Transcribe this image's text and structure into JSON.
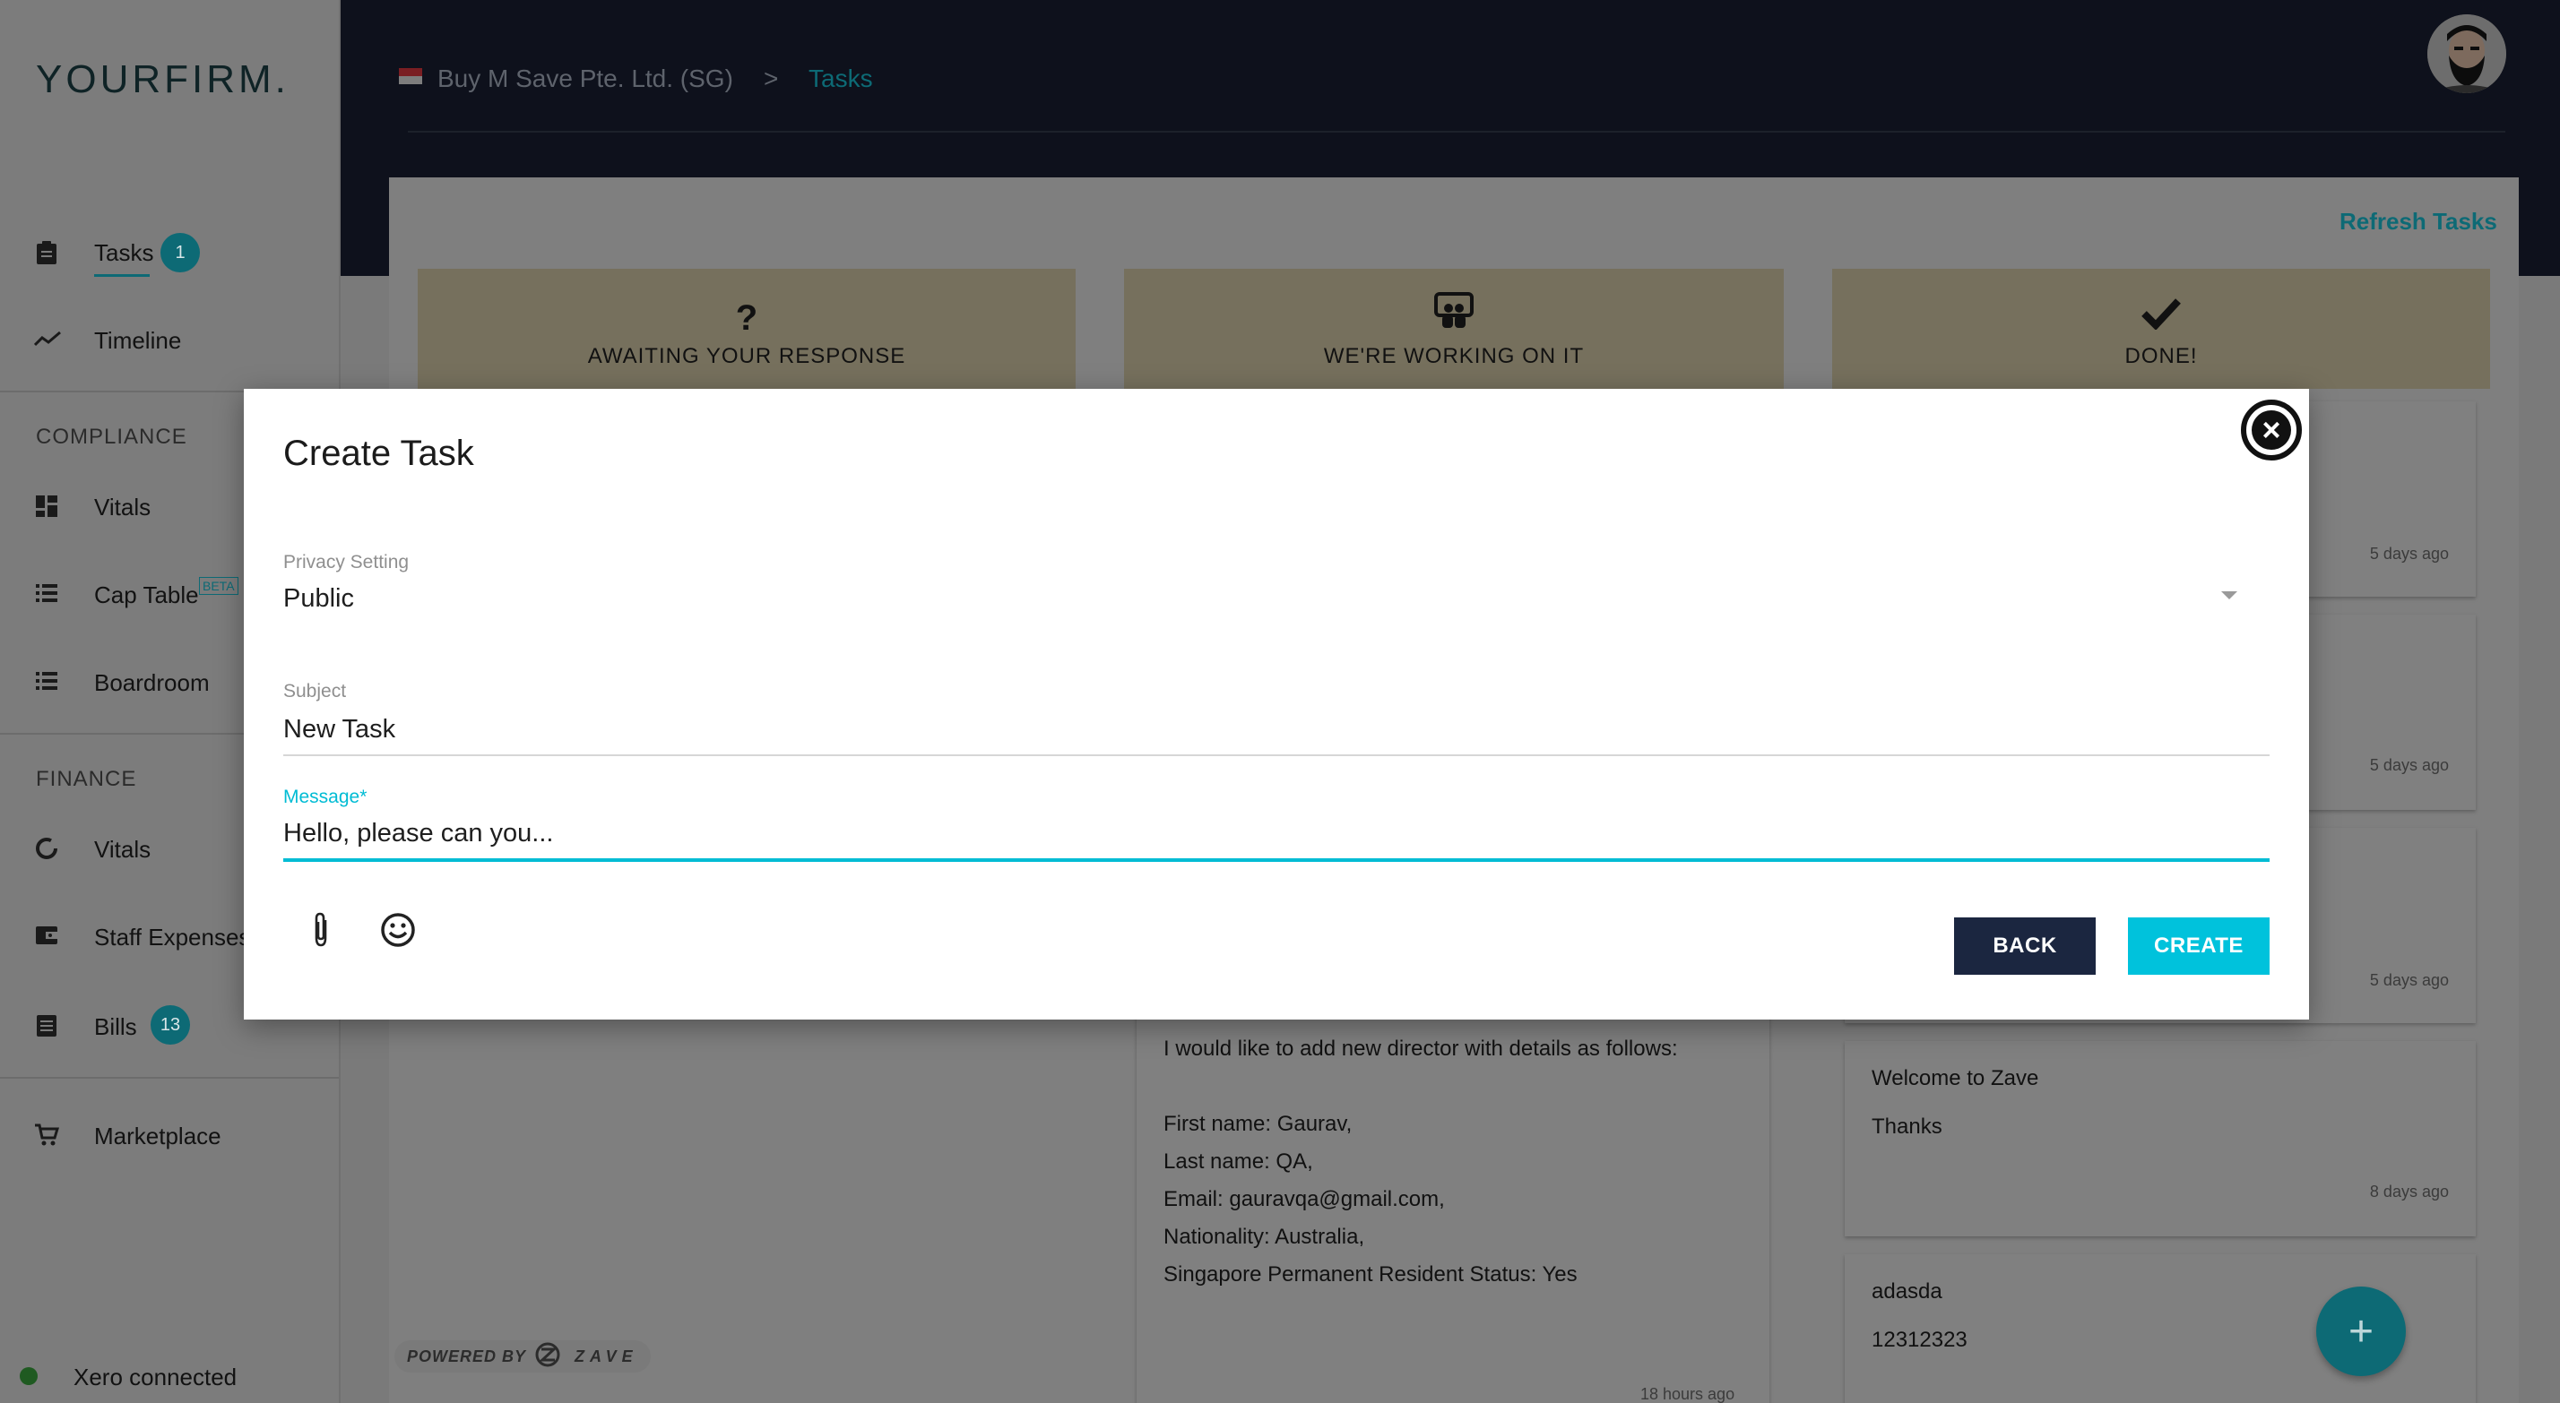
{
  "brand": {
    "logo": "YOURFIRM."
  },
  "sidebar": {
    "items": [
      {
        "label": "Tasks",
        "badge": "1"
      },
      {
        "label": "Timeline"
      }
    ],
    "compliance": {
      "heading": "COMPLIANCE",
      "items": [
        {
          "label": "Vitals"
        },
        {
          "label": "Cap Table",
          "tag": "BETA"
        },
        {
          "label": "Boardroom"
        }
      ]
    },
    "finance": {
      "heading": "FINANCE",
      "items": [
        {
          "label": "Vitals"
        },
        {
          "label": "Staff Expenses"
        },
        {
          "label": "Bills",
          "badge": "13"
        }
      ]
    },
    "marketplace": {
      "label": "Marketplace"
    },
    "status": {
      "label": "Xero connected"
    }
  },
  "header": {
    "company": "Buy M Save Pte. Ltd. (SG)",
    "separator": ">",
    "current": "Tasks"
  },
  "board": {
    "refresh_label": "Refresh Tasks",
    "columns": [
      {
        "title": "AWAITING YOUR RESPONSE",
        "icon": "question-icon"
      },
      {
        "title": "WE'RE WORKING ON IT",
        "icon": "team-icon"
      },
      {
        "title": "DONE!",
        "icon": "check-icon"
      }
    ],
    "done_cards": [
      {
        "time": "5 days ago"
      },
      {
        "time": "5 days ago"
      },
      {
        "time": "5 days ago"
      },
      {
        "title": "Welcome to Zave",
        "body": "Thanks",
        "time": "8 days ago"
      },
      {
        "title": "adasda",
        "body": "12312323",
        "time": ""
      }
    ],
    "working_card": {
      "lines": [
        "I would like to add new director with details as follows:",
        "",
        "First name: Gaurav,",
        "Last name: QA,",
        "Email: gauravqa@gmail.com,",
        "Nationality: Australia,",
        "Singapore Permanent Resident Status: Yes"
      ],
      "time": "18 hours ago"
    },
    "powered_by": "POWERED BY",
    "powered_brand": "ZAVE"
  },
  "modal": {
    "title": "Create Task",
    "privacy": {
      "label": "Privacy Setting",
      "value": "Public"
    },
    "subject": {
      "label": "Subject",
      "value": "New Task"
    },
    "message": {
      "label": "Message*",
      "value": "Hello, please can you..."
    },
    "back_label": "BACK",
    "create_label": "CREATE"
  },
  "colors": {
    "accent": "#00bcd4",
    "navy": "#1b2640",
    "topbar": "#1c2237",
    "column_header": "#ece0bb"
  }
}
